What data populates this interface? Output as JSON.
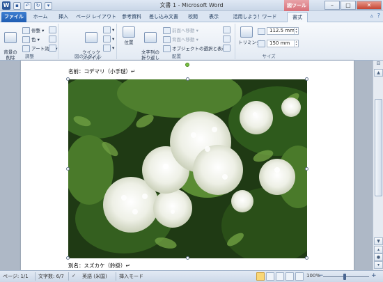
{
  "window": {
    "title": "文書 1 - Microsoft Word",
    "contextual_tab_header": "図ツール",
    "app_icon": "W",
    "controls": {
      "minimize": "–",
      "maximize": "□",
      "close": "✕"
    }
  },
  "tabs": {
    "file": "ファイル",
    "items": [
      "ホーム",
      "挿入",
      "ページ レイアウト",
      "参考資料",
      "差し込み文書",
      "校閲",
      "表示",
      "活用しよう！ワード",
      "書式"
    ],
    "active_index": 8
  },
  "ribbon": {
    "adjust": {
      "remove_bg_label": "背景の\n削除",
      "corrections": "修整",
      "color": "色",
      "artistic_effects": "アート効果",
      "group_label": "調整"
    },
    "styles": {
      "quick_styles": "クイック\nスタイル",
      "group_label": "図のスタイル"
    },
    "arrange": {
      "position": "位置",
      "wrap_text": "文字列の\n折り返し",
      "bring_forward": "前面へ移動",
      "send_backward": "背面へ移動",
      "selection_pane": "オブジェクトの選択と表示",
      "group_label": "配置"
    },
    "size": {
      "crop": "トリミング",
      "height_value": "112.5 mm",
      "width_value": "150 mm",
      "group_label": "サイズ"
    }
  },
  "document": {
    "caption_top": "名前：コデマリ（小手毬）↵",
    "caption_bottom": "別名：スズカケ（鈴掛）↵"
  },
  "status": {
    "page": "ページ: 1/1",
    "word_count": "文字数: 6/7",
    "language": "英語 (米国)",
    "mode": "挿入モード",
    "zoom": "100%"
  }
}
